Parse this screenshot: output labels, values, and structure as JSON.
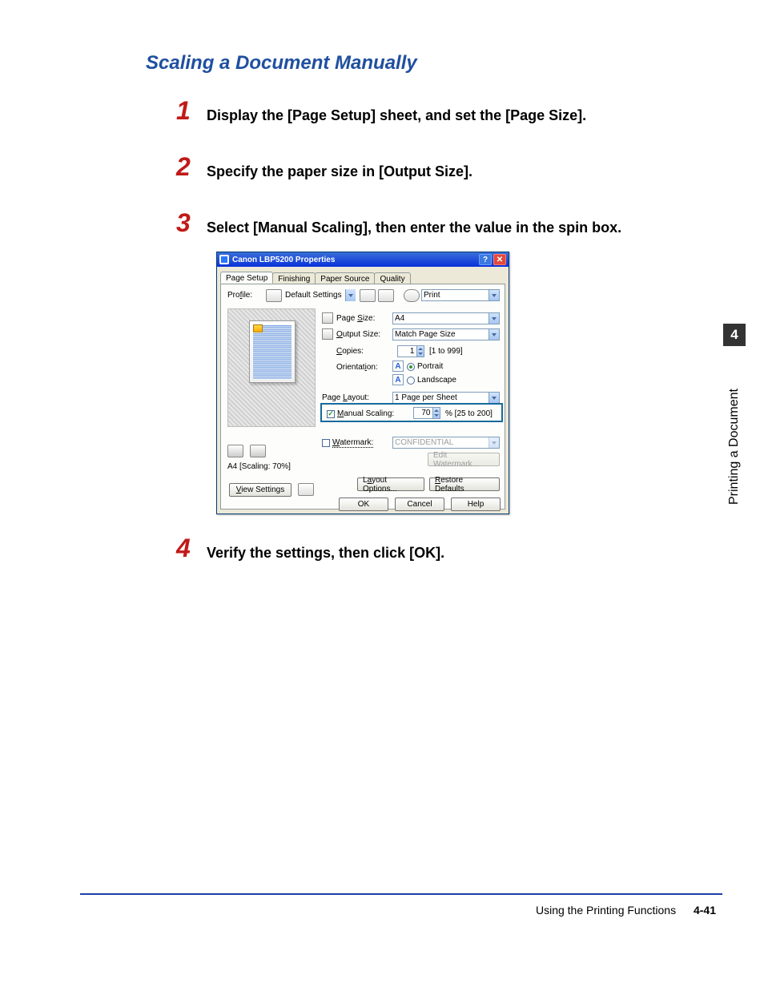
{
  "heading": "Scaling a Document Manually",
  "steps": {
    "s1": "Display the [Page Setup] sheet, and set the [Page Size].",
    "s2": "Specify the paper size in [Output Size].",
    "s3": "Select [Manual Scaling], then enter the value in the spin box.",
    "s4": "Verify the settings, then click [OK]."
  },
  "sidetab": {
    "chapter": "4",
    "label": "Printing a Document"
  },
  "footer": {
    "text": "Using the Printing Functions",
    "page": "4-41"
  },
  "dialog": {
    "title": "Canon LBP5200 Properties",
    "tabs": {
      "t0": "Page Setup",
      "t1": "Finishing",
      "t2": "Paper Source",
      "t3": "Quality"
    },
    "profile_label": "Profile:",
    "profile_value": "Default Settings",
    "print_value": "Print",
    "page_size_label": "Page Size:",
    "page_size_value": "A4",
    "output_size_label": "Output Size:",
    "output_size_value": "Match Page Size",
    "copies_label": "Copies:",
    "copies_value": "1",
    "copies_range": "[1 to 999]",
    "orientation_label": "Orientation:",
    "orientation_portrait": "Portrait",
    "orientation_landscape": "Landscape",
    "page_layout_label": "Page Layout:",
    "page_layout_value": "1 Page per Sheet",
    "manual_scaling_label": "Manual Scaling:",
    "manual_scaling_value": "70",
    "manual_scaling_range": "% [25 to 200]",
    "watermark_label": "Watermark:",
    "watermark_value": "CONFIDENTIAL",
    "edit_watermark": "Edit Watermark...",
    "preview_caption": "A4 [Scaling: 70%]",
    "view_settings": "View Settings",
    "layout_options": "Layout Options...",
    "restore_defaults": "Restore Defaults",
    "ok": "OK",
    "cancel": "Cancel",
    "help": "Help",
    "orient_A": "A"
  }
}
